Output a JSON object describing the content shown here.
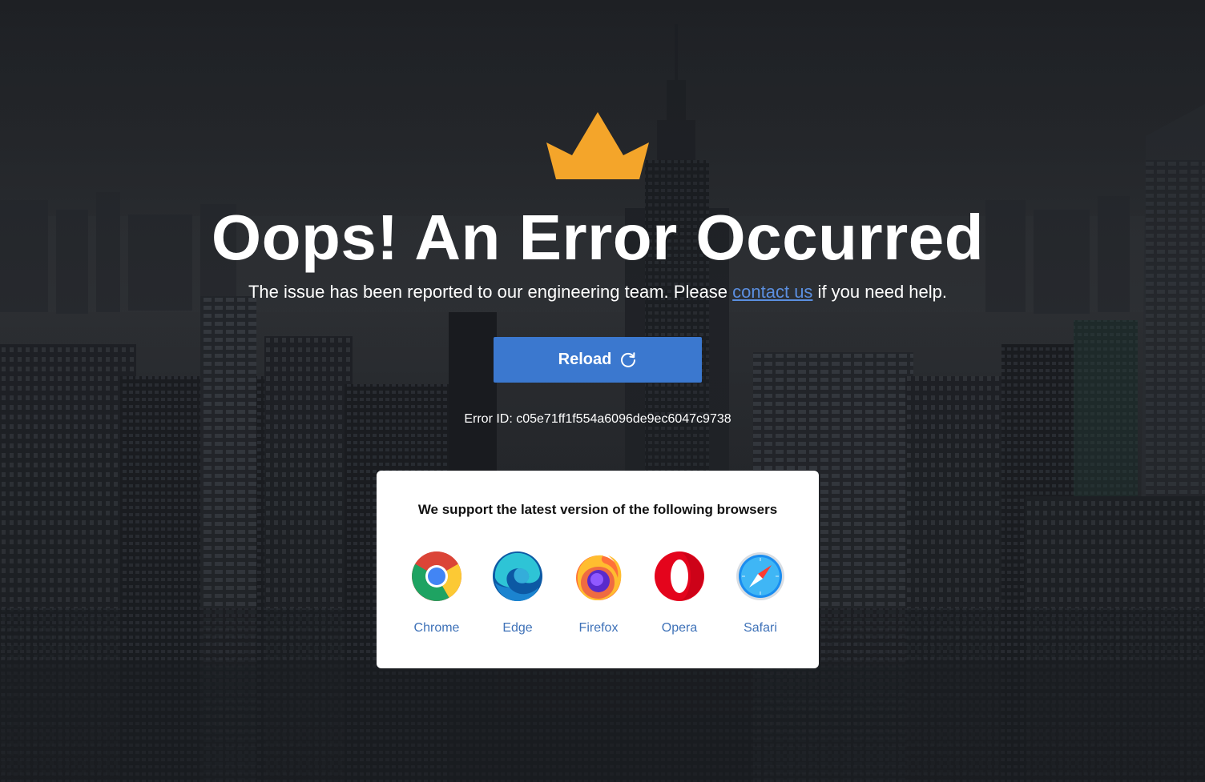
{
  "page": {
    "title": "Oops! An Error Occurred",
    "subtitle_before": "The issue has been reported to our engineering team. Please ",
    "subtitle_link": "contact us",
    "subtitle_after": " if you need help.",
    "reload_label": "Reload",
    "error_id": "Error ID: c05e71ff1f554a6096de9ec6047c9738",
    "accent_color": "#3b78cf",
    "crown_color": "#f4a52a",
    "link_color": "#5b8fe0"
  },
  "browsers_card": {
    "title": "We support the latest version of the following browsers",
    "items": [
      {
        "name": "Chrome",
        "icon": "chrome-icon"
      },
      {
        "name": "Edge",
        "icon": "edge-icon"
      },
      {
        "name": "Firefox",
        "icon": "firefox-icon"
      },
      {
        "name": "Opera",
        "icon": "opera-icon"
      },
      {
        "name": "Safari",
        "icon": "safari-icon"
      }
    ]
  }
}
